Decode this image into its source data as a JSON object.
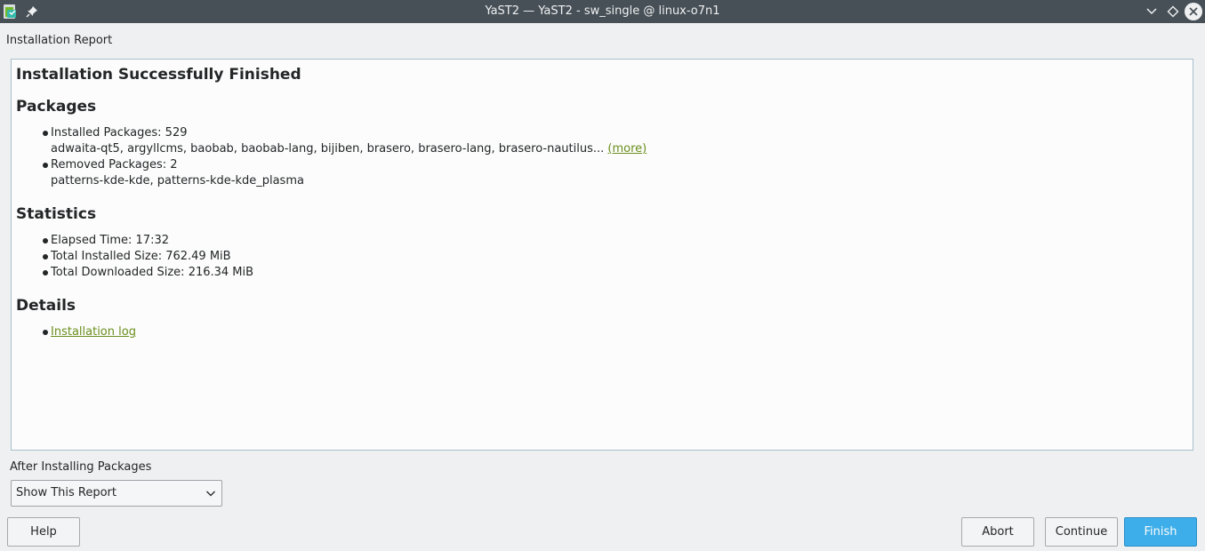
{
  "window": {
    "title": "YaST2 — YaST2 - sw_single @ linux-o7n1"
  },
  "page": {
    "heading": "Installation Report"
  },
  "report": {
    "title": "Installation Successfully Finished",
    "packages": {
      "heading": "Packages",
      "installed_label": "Installed Packages: 529",
      "installed_list": "adwaita-qt5, argyllcms, baobab, baobab-lang, bijiben, brasero, brasero-lang, brasero-nautilus...",
      "more_link": "(more)",
      "removed_label": "Removed Packages: 2",
      "removed_list": "patterns-kde-kde, patterns-kde-kde_plasma"
    },
    "statistics": {
      "heading": "Statistics",
      "elapsed": "Elapsed Time: 17:32",
      "installed_size": "Total Installed Size: 762.49 MiB",
      "downloaded_size": "Total Downloaded Size: 216.34 MiB"
    },
    "details": {
      "heading": "Details",
      "log_link": "Installation log"
    }
  },
  "after_install": {
    "label": "After Installing Packages",
    "selected": "Show This Report"
  },
  "buttons": {
    "help": "Help",
    "abort": "Abort",
    "continue": "Continue",
    "finish": "Finish"
  },
  "colors": {
    "titlebar": "#475057",
    "accent": "#3daee9",
    "link": "#6a8f1d",
    "panel_border": "#a7c0cc"
  },
  "icons": {
    "app": "yast-app-icon",
    "pin": "pin-icon",
    "minimize": "chevron-down-icon",
    "maximize": "diamond-icon",
    "close": "close-icon",
    "combo": "chevron-down-icon"
  }
}
